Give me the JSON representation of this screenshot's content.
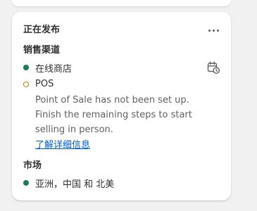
{
  "card": {
    "title": "正在发布",
    "more_icon": "more-horizontal-icon"
  },
  "sales_channels": {
    "heading": "销售渠道",
    "items": [
      {
        "name": "在线商店",
        "status": "active",
        "status_color": "#1a7a5a",
        "action_icon": "calendar-schedule-icon"
      },
      {
        "name": "POS",
        "status": "inactive",
        "status_color": "#b28400",
        "description": "Point of Sale has not been set up. Finish the remaining steps to start selling in person.",
        "link_label": "了解详细信息"
      }
    ]
  },
  "markets": {
    "heading": "市场",
    "items": [
      {
        "name": "亚洲，中国 和 北美",
        "status": "active",
        "status_color": "#1a7a5a"
      }
    ]
  },
  "colors": {
    "link": "#005bd3",
    "background": "#f1f1f1"
  }
}
